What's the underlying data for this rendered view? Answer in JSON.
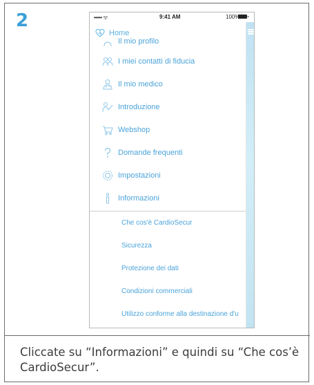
{
  "step_number": "2",
  "status_bar": {
    "signal": "••••• ᯤ",
    "time": "9:41 AM",
    "battery": "100%"
  },
  "menu": {
    "header": "Home",
    "items": [
      {
        "label": "Il mio profilo",
        "icon": "profile-icon"
      },
      {
        "label": "I miei contatti di fiducia",
        "icon": "contacts-icon"
      },
      {
        "label": "Il mio medico",
        "icon": "doctor-icon"
      },
      {
        "label": "Introduzione",
        "icon": "introduction-icon"
      },
      {
        "label": "Webshop",
        "icon": "cart-icon"
      },
      {
        "label": "Domande frequenti",
        "icon": "question-icon"
      },
      {
        "label": "Impostazioni",
        "icon": "settings-icon"
      },
      {
        "label": "Informazioni",
        "icon": "info-icon"
      }
    ],
    "submenu": [
      "Che cos'è CardioSecur",
      "Sicurezza",
      "Protezione dei dati",
      "Condizioni commerciali",
      "Utilizzo conforme alla destinazione d'u"
    ]
  },
  "caption": "Cliccate su “Informazioni” e quindi su “Che cos’è CardioSecur”.",
  "colors": {
    "accent": "#3aa0d8",
    "menu_text": "#4aa3d9",
    "strip": "#c9e8f5"
  }
}
